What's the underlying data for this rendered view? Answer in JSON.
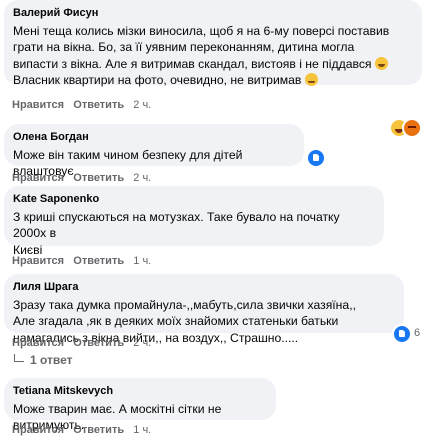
{
  "comments": [
    {
      "author": "Валерий Фисун",
      "lines": [
        "Мені теща колись мізки виносила, щоб я на 6-му поверсі поставив",
        "грати на вікна. Бо, за її уявним переконанням, дитина могла",
        "випасти з вікна. Але я витримав скандал, вистояв і не піддався",
        "Власник квартири на фото, очевидно, не витримав"
      ],
      "emoji_after": [
        "grinning-emoji",
        "grimace-emoji"
      ],
      "like_label": "Нравится",
      "reply_label": "Ответить",
      "time": "2 ч.",
      "reactions": [
        "haha",
        "angry"
      ]
    },
    {
      "author": "Олена Богдан",
      "lines": [
        "Може він таким чином безпеку для дітей влаштовує"
      ],
      "like_label": "Нравится",
      "reply_label": "Ответить",
      "time": "2 ч.",
      "reactions": [
        "like"
      ]
    },
    {
      "author": "Kate Saponenko",
      "lines": [
        "З криші спускаються на мотузках. Таке бувало на початку 2000х в",
        "Києві"
      ],
      "like_label": "Нравится",
      "reply_label": "Ответить",
      "time": "1 ч."
    },
    {
      "author": "Лиля Шрага",
      "lines": [
        "Зразу така думка промайнула-,,мабуть,сила звички хазяїна,,",
        "Але згадала ,як в деяких моїх знайомих статеньки батьки",
        "намагались з вікна вийти,, на воздух,, Страшно....."
      ],
      "like_label": "Нравится",
      "reply_label": "Ответить",
      "time": "2 ч.",
      "reactions": [
        "like"
      ],
      "reaction_count": "6",
      "replies_label": "1 ответ"
    },
    {
      "author": "Tetiana Mitskevych",
      "lines": [
        "Може тварин має. А москітні сітки не витримують."
      ],
      "like_label": "Нравится",
      "reply_label": "Ответить",
      "time": "1 ч."
    }
  ]
}
